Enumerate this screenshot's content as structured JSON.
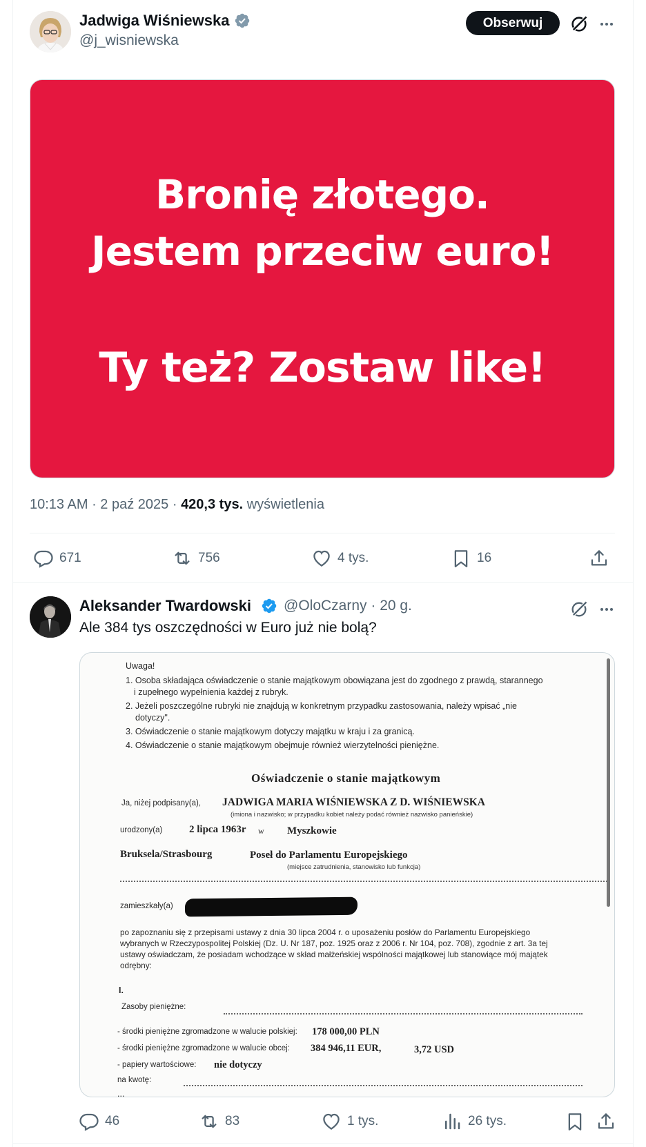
{
  "main_tweet": {
    "author_name": "Jadwiga Wiśniewska",
    "author_handle": "@j_wisniewska",
    "follow_label": "Obserwuj",
    "image_lines": [
      "Bronię złotego.",
      "Jestem przeciw euro!",
      "Ty też? Zostaw like!"
    ],
    "time": "10:13 AM",
    "date": "2 paź 2025",
    "views_count": "420,3 tys.",
    "views_label": "wyświetlenia",
    "replies": "671",
    "retweets": "756",
    "likes": "4 tys.",
    "bookmarks": "16"
  },
  "reply_tweet": {
    "author_name": "Aleksander Twardowski",
    "author_handle": "@OloCzarny",
    "age": "20 g.",
    "text": "Ale 384 tys oszczędności w Euro już nie bolą?",
    "replies": "46",
    "retweets": "83",
    "likes": "1 tys.",
    "views": "26 tys."
  },
  "document": {
    "uwaga": "Uwaga!",
    "rule1a": "1. Osoba składająca oświadczenie o stanie majątkowym obowiązana jest do zgodnego z prawdą, starannego",
    "rule1b": "i  zupełnego wypełnienia każdej z rubryk.",
    "rule2a": "2. Jeżeli poszczególne rubryki nie znajdują w konkretnym przypadku zastosowania, należy wpisać „nie",
    "rule2b": "dotyczy\".",
    "rule3": "3. Oświadczenie o stanie majątkowym dotyczy majątku w kraju i za granicą.",
    "rule4": "4. Oświadczenie o stanie majątkowym obejmuje również wierzytelności pieniężne.",
    "heading": "Oświadczenie o stanie majątkowym",
    "signed_label": "Ja, niżej podpisany(a),",
    "signed_name": "JADWIGA MARIA  WIŚNIEWSKA  Z D. WIŚNIEWSKA",
    "name_hint": "(imiona i nazwisko; w przypadku kobiet należy podać również nazwisko panieńskie)",
    "born_label": "urodzony(a)",
    "born_date": "2 lipca 1963r",
    "born_in": "w",
    "born_place": "Myszkowie",
    "workplace": "Bruksela/Strasbourg",
    "position": "Poseł do Parlamentu Europejskiego",
    "position_hint": "(miejsce zatrudnienia, stanowisko lub funkcja)",
    "residence_label": "zamieszkały(a)",
    "para1": "po zapoznaniu się z przepisami ustawy z dnia 30 lipca 2004 r. o uposażeniu posłów do Parlamentu Europejskiego",
    "para2": "wybranych w Rzeczypospolitej Polskiej (Dz. U. Nr 187, poz. 1925 oraz z 2006 r. Nr 104, poz. 708), zgodnie z art. 3a tej",
    "para3": "ustawy oświadczam, że posiadam wchodzące w skład małżeńskiej wspólności majątkowej lub stanowiące mój majątek",
    "para4": "odrębny:",
    "section": "I.",
    "cash_label": "Zasoby pieniężne:",
    "pln_label": "- środki pieniężne zgromadzone w walucie polskiej:",
    "pln_value": "178 000,00 PLN",
    "foreign_label": "- środki pieniężne zgromadzone w walucie obcej:",
    "eur_value": "384 946,11 EUR,",
    "usd_value": "3,72 USD",
    "securities_label": "- papiery wartościowe:",
    "securities_value": "nie dotyczy",
    "amount_label": "na kwotę:",
    "trail": "..."
  }
}
